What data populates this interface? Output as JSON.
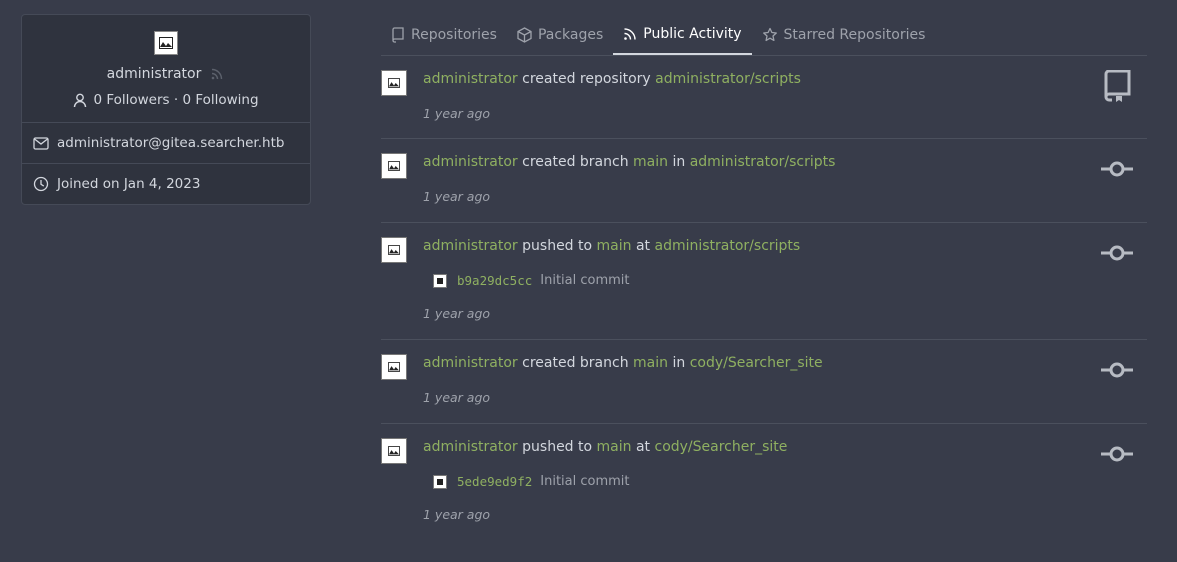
{
  "profile": {
    "username": "administrator",
    "followers": "0 Followers · 0 Following",
    "email": "administrator@gitea.searcher.htb",
    "joined": "Joined on Jan 4, 2023"
  },
  "tabs": [
    {
      "label": "Repositories",
      "icon": "repo-icon"
    },
    {
      "label": "Packages",
      "icon": "package-icon"
    },
    {
      "label": "Public Activity",
      "icon": "rss-icon",
      "active": true
    },
    {
      "label": "Starred Repositories",
      "icon": "star-icon"
    }
  ],
  "feed": [
    {
      "user": "administrator",
      "action": "created repository",
      "repo": "administrator/scripts",
      "time": "1 year ago",
      "icon": "repo-icon"
    },
    {
      "user": "administrator",
      "action": "created branch",
      "branch": "main",
      "conj": "in",
      "repo": "administrator/scripts",
      "time": "1 year ago",
      "icon": "git-commit-icon"
    },
    {
      "user": "administrator",
      "action": "pushed to",
      "branch": "main",
      "conj": "at",
      "repo": "administrator/scripts",
      "commit_sha": "b9a29dc5cc",
      "commit_msg": "Initial commit",
      "time": "1 year ago",
      "icon": "git-commit-icon"
    },
    {
      "user": "administrator",
      "action": "created branch",
      "branch": "main",
      "conj": "in",
      "repo": "cody/Searcher_site",
      "time": "1 year ago",
      "icon": "git-commit-icon"
    },
    {
      "user": "administrator",
      "action": "pushed to",
      "branch": "main",
      "conj": "at",
      "repo": "cody/Searcher_site",
      "commit_sha": "5ede9ed9f2",
      "commit_msg": "Initial commit",
      "time": "1 year ago",
      "icon": "git-commit-icon"
    }
  ],
  "colors": {
    "background": "#383c4a",
    "accent_green": "#8fb061",
    "muted": "#9ea2ab"
  }
}
